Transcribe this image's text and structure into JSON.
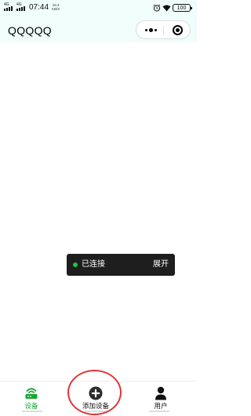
{
  "status_bar": {
    "network_1": "4G",
    "network_2": "4G",
    "time": "07:44",
    "speed_value": "19.3",
    "speed_unit": "KB/S",
    "battery": "100"
  },
  "nav": {
    "title": "QQQQQ"
  },
  "toast": {
    "status_text": "已连接",
    "expand_label": "展开",
    "status_color": "#1ec14a"
  },
  "tabbar": {
    "items": [
      {
        "label": "设备",
        "icon": "router-icon",
        "active": true
      },
      {
        "label": "添加设备",
        "icon": "plus-circle-icon",
        "active": false
      },
      {
        "label": "用户",
        "icon": "user-icon",
        "active": false
      }
    ],
    "active_color": "#16a72f"
  },
  "colors": {
    "header_background": "#f0fdfb",
    "annotation": "#e0333a"
  }
}
